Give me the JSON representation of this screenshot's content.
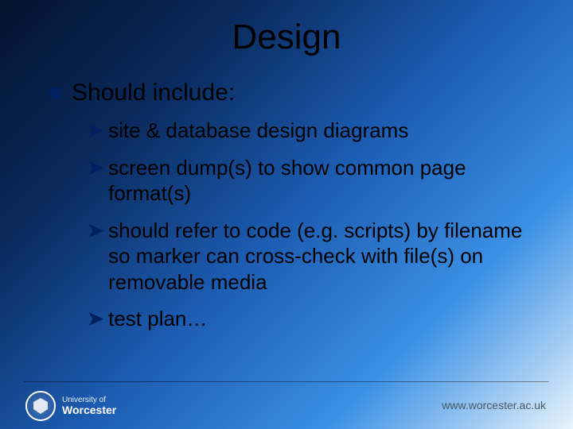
{
  "title": "Design",
  "heading": "Should include:",
  "items": [
    "site & database design diagrams",
    "screen dump(s) to show common page format(s)",
    "should refer to code (e.g. scripts) by filename so marker can cross-check with file(s) on removable media",
    "test plan…"
  ],
  "footer": {
    "org_line1": "University of",
    "org_line2": "Worcester",
    "url": "www.worcester.ac.uk"
  }
}
